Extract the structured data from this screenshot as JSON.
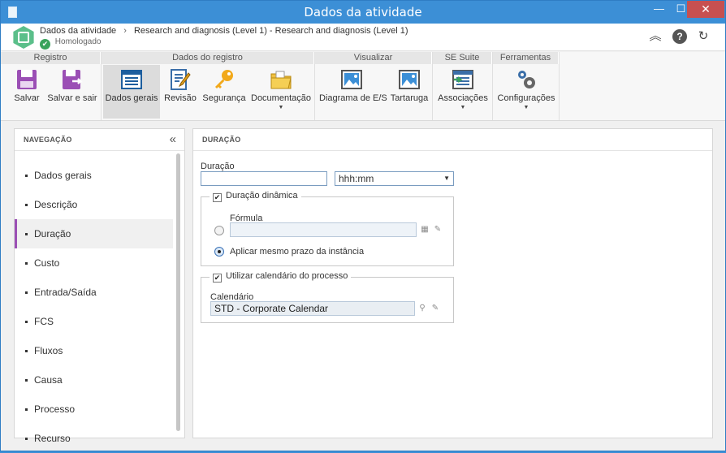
{
  "window": {
    "title": "Dados da atividade",
    "minimize": "—",
    "maximize": "☐",
    "close": "✕"
  },
  "header": {
    "breadcrumb": [
      "Dados da atividade",
      "Research and diagnosis (Level 1) - Research and diagnosis (Level 1)"
    ],
    "separator": "›",
    "status": "Homologado",
    "status_icon": "✔"
  },
  "ribbon": {
    "groups": [
      "Registro",
      "Dados do registro",
      "Visualizar",
      "SE Suite",
      "Ferramentas"
    ],
    "buttons": {
      "salvar": "Salvar",
      "salvar_e_sair": "Salvar e sair",
      "dados_gerais": "Dados gerais",
      "revisao": "Revisão",
      "seguranca": "Segurança",
      "documentacao": "Documentação",
      "diagrama": "Diagrama de E/S",
      "tartaruga": "Tartaruga",
      "associacoes": "Associações",
      "configuracoes": "Configurações"
    }
  },
  "navigation": {
    "title": "NAVEGAÇÃO",
    "collapse": "«",
    "items": [
      "Dados gerais",
      "Descrição",
      "Duração",
      "Custo",
      "Entrada/Saída",
      "FCS",
      "Fluxos",
      "Causa",
      "Processo",
      "Recurso"
    ]
  },
  "panel": {
    "title": "DURAÇÃO",
    "duration_label": "Duração",
    "duration_value": "",
    "format_selected": "hhh:mm",
    "dynamic": {
      "label": "Duração dinâmica",
      "checked": "✔"
    },
    "formula_label": "Fórmula",
    "apply_label": "Aplicar mesmo prazo da instância",
    "calendar_group": {
      "label": "Utilizar calendário do processo",
      "checked": "✔"
    },
    "calendar_label": "Calendário",
    "calendar_value": "STD - Corporate Calendar"
  },
  "colors": {
    "titlebar": "#3c8fd6",
    "active_accent": "#9b4fb5",
    "status_ok": "#3aa35c",
    "close": "#c75050"
  }
}
